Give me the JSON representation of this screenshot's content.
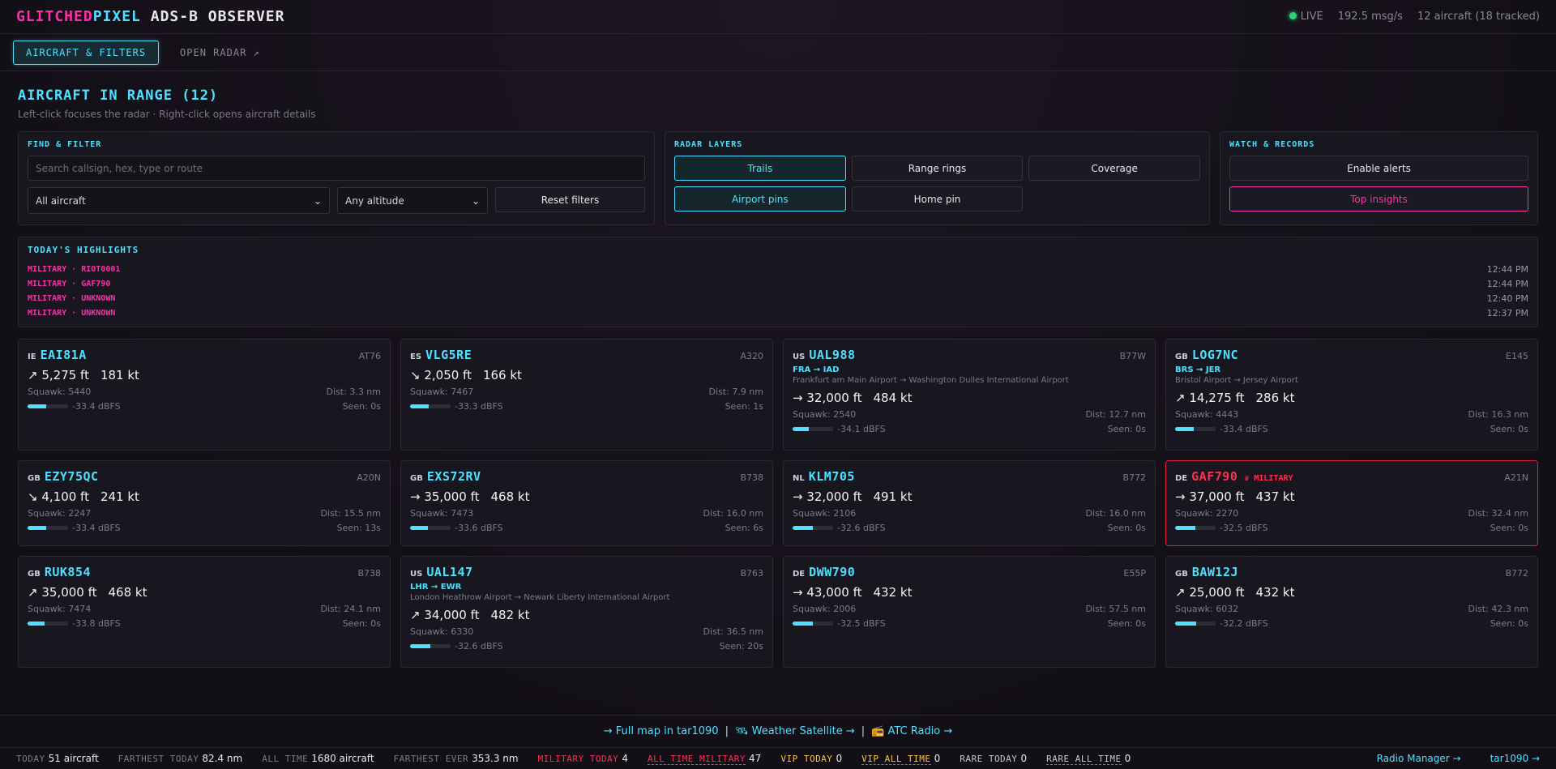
{
  "header": {
    "brand_part1": "GLITCHED",
    "brand_part2": "PIXEL",
    "brand_part3": "ADS-B OBSERVER",
    "live_label": "LIVE",
    "msg_rate": "192.5 msg/s",
    "aircraft_count": "12 aircraft (18 tracked)"
  },
  "nav": {
    "tab_active": "AIRCRAFT & FILTERS",
    "tab_link": "OPEN RADAR ↗"
  },
  "page": {
    "title": "AIRCRAFT IN RANGE (12)",
    "subtitle": "Left-click focuses the radar · Right-click opens aircraft details"
  },
  "find_filter": {
    "title": "FIND & FILTER",
    "search_placeholder": "Search callsign, hex, type or route",
    "aircraft_select": "All aircraft",
    "altitude_select": "Any altitude",
    "reset_label": "Reset filters"
  },
  "radar_layers": {
    "title": "RADAR LAYERS",
    "trails": "Trails",
    "range_rings": "Range rings",
    "coverage": "Coverage",
    "airport_pins": "Airport pins",
    "home_pin": "Home pin"
  },
  "watch": {
    "title": "WATCH & RECORDS",
    "enable_alerts": "Enable alerts",
    "top_insights": "Top insights"
  },
  "highlights": {
    "title": "TODAY'S HIGHLIGHTS",
    "items": [
      {
        "text": "MILITARY · RIOT0001",
        "time": "12:44 PM"
      },
      {
        "text": "MILITARY · GAF790",
        "time": "12:44 PM"
      },
      {
        "text": "MILITARY · UNKNOWN",
        "time": "12:40 PM"
      },
      {
        "text": "MILITARY · UNKNOWN",
        "time": "12:37 PM"
      }
    ]
  },
  "aircraft": [
    {
      "cc": "IE",
      "call": "EAI81A",
      "type": "AT76",
      "alt": "↗ 5,275 ft",
      "spd": "181 kt",
      "squawk": "Squawk: 5440",
      "dist": "Dist: 3.3 nm",
      "signal": "-33.4 dBFS",
      "seen": "Seen: 0s",
      "sig_pct": 45,
      "route": "",
      "route_full": "",
      "military": false,
      "mil_label": ""
    },
    {
      "cc": "ES",
      "call": "VLG5RE",
      "type": "A320",
      "alt": "↘ 2,050 ft",
      "spd": "166 kt",
      "squawk": "Squawk: 7467",
      "dist": "Dist: 7.9 nm",
      "signal": "-33.3 dBFS",
      "seen": "Seen: 1s",
      "sig_pct": 45,
      "route": "",
      "route_full": "",
      "military": false,
      "mil_label": ""
    },
    {
      "cc": "US",
      "call": "UAL988",
      "type": "B77W",
      "alt": "→ 32,000 ft",
      "spd": "484 kt",
      "squawk": "Squawk: 2540",
      "dist": "Dist: 12.7 nm",
      "signal": "-34.1 dBFS",
      "seen": "Seen: 0s",
      "sig_pct": 40,
      "route": "FRA → IAD",
      "route_full": "Frankfurt am Main Airport → Washington Dulles International Airport",
      "military": false,
      "mil_label": ""
    },
    {
      "cc": "GB",
      "call": "LOG7NC",
      "type": "E145",
      "alt": "↗ 14,275 ft",
      "spd": "286 kt",
      "squawk": "Squawk: 4443",
      "dist": "Dist: 16.3 nm",
      "signal": "-33.4 dBFS",
      "seen": "Seen: 0s",
      "sig_pct": 45,
      "route": "BRS → JER",
      "route_full": "Bristol Airport → Jersey Airport",
      "military": false,
      "mil_label": ""
    },
    {
      "cc": "GB",
      "call": "EZY75QC",
      "type": "A20N",
      "alt": "↘ 4,100 ft",
      "spd": "241 kt",
      "squawk": "Squawk: 2247",
      "dist": "Dist: 15.5 nm",
      "signal": "-33.4 dBFS",
      "seen": "Seen: 13s",
      "sig_pct": 45,
      "route": "",
      "route_full": "",
      "military": false,
      "mil_label": ""
    },
    {
      "cc": "GB",
      "call": "EXS72RV",
      "type": "B738",
      "alt": "→ 35,000 ft",
      "spd": "468 kt",
      "squawk": "Squawk: 7473",
      "dist": "Dist: 16.0 nm",
      "signal": "-33.6 dBFS",
      "seen": "Seen: 6s",
      "sig_pct": 44,
      "route": "",
      "route_full": "",
      "military": false,
      "mil_label": ""
    },
    {
      "cc": "NL",
      "call": "KLM705",
      "type": "B772",
      "alt": "→ 32,000 ft",
      "spd": "491 kt",
      "squawk": "Squawk: 2106",
      "dist": "Dist: 16.0 nm",
      "signal": "-32.6 dBFS",
      "seen": "Seen: 0s",
      "sig_pct": 50,
      "route": "",
      "route_full": "",
      "military": false,
      "mil_label": ""
    },
    {
      "cc": "DE",
      "call": "GAF790",
      "type": "A21N",
      "alt": "→ 37,000 ft",
      "spd": "437 kt",
      "squawk": "Squawk: 2270",
      "dist": "Dist: 32.4 nm",
      "signal": "-32.5 dBFS",
      "seen": "Seen: 0s",
      "sig_pct": 50,
      "route": "",
      "route_full": "",
      "military": true,
      "mil_label": "♛ MILITARY"
    },
    {
      "cc": "GB",
      "call": "RUK854",
      "type": "B738",
      "alt": "↗ 35,000 ft",
      "spd": "468 kt",
      "squawk": "Squawk: 7474",
      "dist": "Dist: 24.1 nm",
      "signal": "-33.8 dBFS",
      "seen": "Seen: 0s",
      "sig_pct": 42,
      "route": "",
      "route_full": "",
      "military": false,
      "mil_label": ""
    },
    {
      "cc": "US",
      "call": "UAL147",
      "type": "B763",
      "alt": "↗ 34,000 ft",
      "spd": "482 kt",
      "squawk": "Squawk: 6330",
      "dist": "Dist: 36.5 nm",
      "signal": "-32.6 dBFS",
      "seen": "Seen: 20s",
      "sig_pct": 50,
      "route": "LHR → EWR",
      "route_full": "London Heathrow Airport → Newark Liberty International Airport",
      "military": false,
      "mil_label": ""
    },
    {
      "cc": "DE",
      "call": "DWW790",
      "type": "E55P",
      "alt": "→ 43,000 ft",
      "spd": "432 kt",
      "squawk": "Squawk: 2006",
      "dist": "Dist: 57.5 nm",
      "signal": "-32.5 dBFS",
      "seen": "Seen: 0s",
      "sig_pct": 50,
      "route": "",
      "route_full": "",
      "military": false,
      "mil_label": ""
    },
    {
      "cc": "GB",
      "call": "BAW12J",
      "type": "B772",
      "alt": "↗ 25,000 ft",
      "spd": "432 kt",
      "squawk": "Squawk: 6032",
      "dist": "Dist: 42.3 nm",
      "signal": "-32.2 dBFS",
      "seen": "Seen: 0s",
      "sig_pct": 52,
      "route": "",
      "route_full": "",
      "military": false,
      "mil_label": ""
    }
  ],
  "footer_links": {
    "full_map": "→ Full map in tar1090",
    "weather": "🛰 Weather Satellite →",
    "atc": "📻 ATC Radio →"
  },
  "status": {
    "today_label": "TODAY",
    "today_val": "51 aircraft",
    "farthest_today_label": "FARTHEST TODAY",
    "farthest_today_val": "82.4 nm",
    "all_time_label": "ALL TIME",
    "all_time_val": "1680 aircraft",
    "farthest_ever_label": "FARTHEST EVER",
    "farthest_ever_val": "353.3 nm",
    "mil_today_label": "MILITARY TODAY",
    "mil_today_val": "4",
    "mil_all_label": "ALL TIME MILITARY",
    "mil_all_val": "47",
    "vip_today_label": "VIP TODAY",
    "vip_today_val": "0",
    "vip_all_label": "VIP ALL TIME",
    "vip_all_val": "0",
    "rare_today_label": "RARE TODAY",
    "rare_today_val": "0",
    "rare_all_label": "RARE ALL TIME",
    "rare_all_val": "0",
    "radio_manager": "Radio Manager →",
    "tar1090": "tar1090 →"
  },
  "colors": {
    "accent_cyan": "#4fe0ff",
    "accent_pink": "#ff2fa8",
    "military_red": "#ff2f4e",
    "vip_yellow": "#ffc23a",
    "live_green": "#2fd27a"
  }
}
